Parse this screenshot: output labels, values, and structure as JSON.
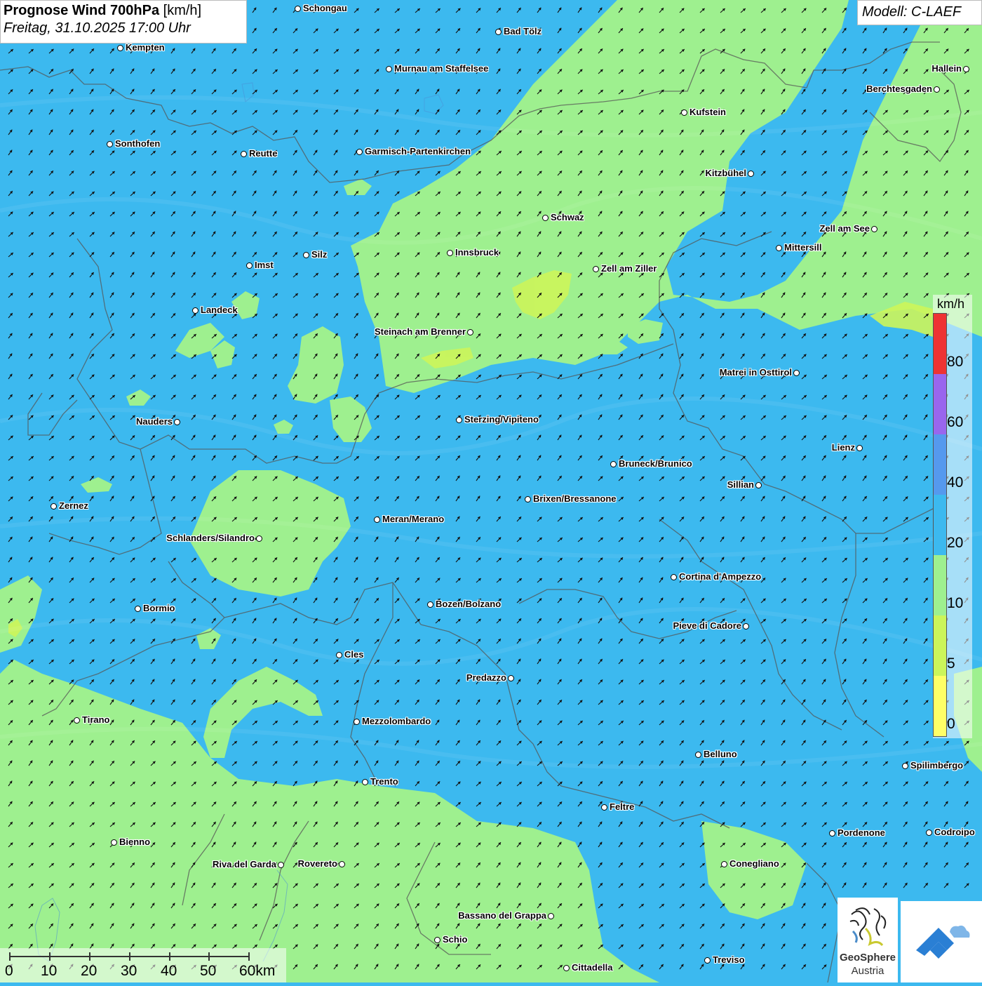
{
  "header": {
    "title_bold": "Prognose Wind 700hPa",
    "title_unit": "[km/h]",
    "datetime": "Freitag, 31.10.2025 17:00 Uhr",
    "model": "Modell: C-LAEF"
  },
  "legend": {
    "unit": "km/h",
    "classes": [
      {
        "from": 0,
        "to": 5,
        "color": "#ffff66"
      },
      {
        "from": 5,
        "to": 10,
        "color": "#ccf55a"
      },
      {
        "from": 10,
        "to": 20,
        "color": "#9ef08f"
      },
      {
        "from": 20,
        "to": 40,
        "color": "#3cb9ef"
      },
      {
        "from": 40,
        "to": 60,
        "color": "#5599ee"
      },
      {
        "from": 60,
        "to": 80,
        "color": "#9966ee"
      },
      {
        "from": 80,
        "to": null,
        "color": "#ee3333"
      }
    ],
    "labels": [
      "0",
      "5",
      "10",
      "20",
      "40",
      "60",
      "80"
    ]
  },
  "scale": {
    "labels": [
      "0",
      "10",
      "20",
      "30",
      "40",
      "50",
      "60km"
    ]
  },
  "wind": {
    "prevailing_direction": "south-west",
    "arrow_color": "#111111"
  },
  "cities": [
    {
      "name": "Schongau"
    },
    {
      "name": "Bad Tölz"
    },
    {
      "name": "Kempten"
    },
    {
      "name": "Murnau am Staffelsee"
    },
    {
      "name": "Hallein"
    },
    {
      "name": "Berchtesgaden"
    },
    {
      "name": "Kufstein"
    },
    {
      "name": "Sonthofen"
    },
    {
      "name": "Reutte"
    },
    {
      "name": "Garmisch-Partenkirchen"
    },
    {
      "name": "Kitzbühel"
    },
    {
      "name": "Schwaz"
    },
    {
      "name": "Zell am See"
    },
    {
      "name": "Mittersill"
    },
    {
      "name": "Imst"
    },
    {
      "name": "Silz"
    },
    {
      "name": "Innsbruck"
    },
    {
      "name": "Zell am Ziller"
    },
    {
      "name": "Landeck"
    },
    {
      "name": "Steinach am Brenner"
    },
    {
      "name": "Matrei in Osttirol"
    },
    {
      "name": "Nauders"
    },
    {
      "name": "Sterzing/Vipiteno"
    },
    {
      "name": "Lienz"
    },
    {
      "name": "Bruneck/Brunico"
    },
    {
      "name": "Sillian"
    },
    {
      "name": "Zernez"
    },
    {
      "name": "Brixen/Bressanone"
    },
    {
      "name": "Meran/Merano"
    },
    {
      "name": "Schlanders/Silandro"
    },
    {
      "name": "Cortina d'Ampezzo"
    },
    {
      "name": "Bormio"
    },
    {
      "name": "Bozen/Bolzano"
    },
    {
      "name": "Pieve di Cadore"
    },
    {
      "name": "Cles"
    },
    {
      "name": "Predazzo"
    },
    {
      "name": "Tirano"
    },
    {
      "name": "Mezzolombardo"
    },
    {
      "name": "Belluno"
    },
    {
      "name": "Spilimbergo"
    },
    {
      "name": "Trento"
    },
    {
      "name": "Feltre"
    },
    {
      "name": "Pordenone"
    },
    {
      "name": "Codroipo"
    },
    {
      "name": "Bienno"
    },
    {
      "name": "Riva del Garda"
    },
    {
      "name": "Rovereto"
    },
    {
      "name": "Conegliano"
    },
    {
      "name": "Bassano del Grappa"
    },
    {
      "name": "Schio"
    },
    {
      "name": "Treviso"
    },
    {
      "name": "Cittadella"
    }
  ],
  "logos": {
    "geosphere_line1": "GeoSphere",
    "geosphere_line2": "Austria",
    "brand_blue": "#2a7fd4"
  }
}
